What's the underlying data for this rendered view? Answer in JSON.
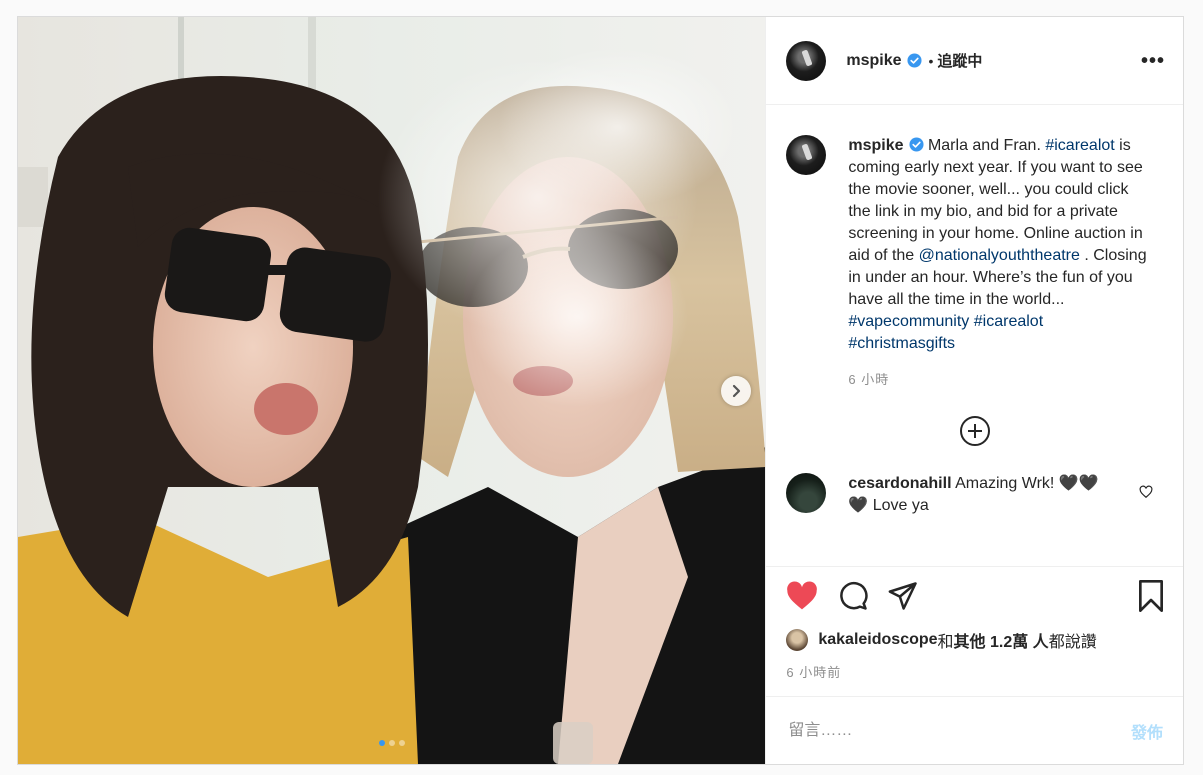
{
  "post": {
    "author": "mspike",
    "follow_separator": "•",
    "follow_label": "追蹤中",
    "more_label": "•••",
    "caption": {
      "author": "mspike",
      "part1": "Marla and Fran. ",
      "tag1": "#icarealot",
      "part2": " is coming early next year. If you want to see the movie sooner, well... you could click the link in my bio, and bid for a private screening in your home. Online auction in aid of the ",
      "mention": "@nationalyouththeatre",
      "part3": " . Closing in under an hour. Where’s the fun of you have all the time in the world... ",
      "tag2": "#vapecommunity",
      "tag3": "#icarealot",
      "tag4": "#christmasgifts",
      "time": "6 小時"
    },
    "comments": [
      {
        "author": "cesardonahill",
        "text": "Amazing Wrk! 🖤🖤 🖤 Love ya"
      }
    ],
    "likes": {
      "user": "kakaleidoscope",
      "and": " 和 ",
      "others": "其他 1.2萬 人",
      "suffix": " 都說讚"
    },
    "posted_time": "6 小時前",
    "comment_input": {
      "placeholder": "留言……",
      "value": ""
    },
    "post_button": "發佈"
  },
  "carousel": {
    "count": 3,
    "active": 1
  },
  "colors": {
    "like_red": "#ed4956",
    "link_blue": "#00376b",
    "verified": "#3897f0",
    "post_disabled": "#b2dffc"
  },
  "icons": [
    "verified-badge-icon",
    "more-options-icon",
    "load-more-plus-icon",
    "heart-outline-icon",
    "heart-filled-icon",
    "comment-bubble-icon",
    "share-send-icon",
    "bookmark-icon",
    "chevron-right-icon"
  ]
}
